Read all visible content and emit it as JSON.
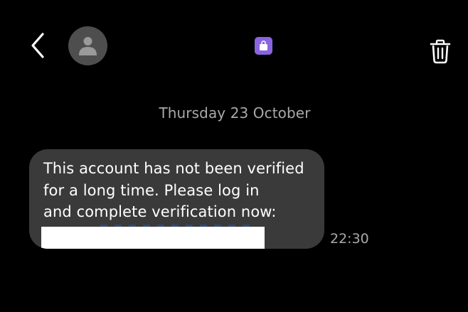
{
  "header": {
    "back_icon": "chevron-left-icon",
    "avatar_icon": "person-icon",
    "sim_icon": "shopping-bag-icon",
    "sim_color": "#8a64e0",
    "delete_icon": "trash-icon"
  },
  "conversation": {
    "date_separator": "Thursday 23 October",
    "messages": [
      {
        "lines": [
          "This account has not been verified",
          "for a long time. Please log in",
          "and complete verification now:"
        ],
        "link_redacted": true,
        "time": "22:30"
      }
    ]
  },
  "colors": {
    "background": "#000000",
    "bubble": "#3a3a3a",
    "text": "#ffffff",
    "muted": "#a9a9a9"
  }
}
